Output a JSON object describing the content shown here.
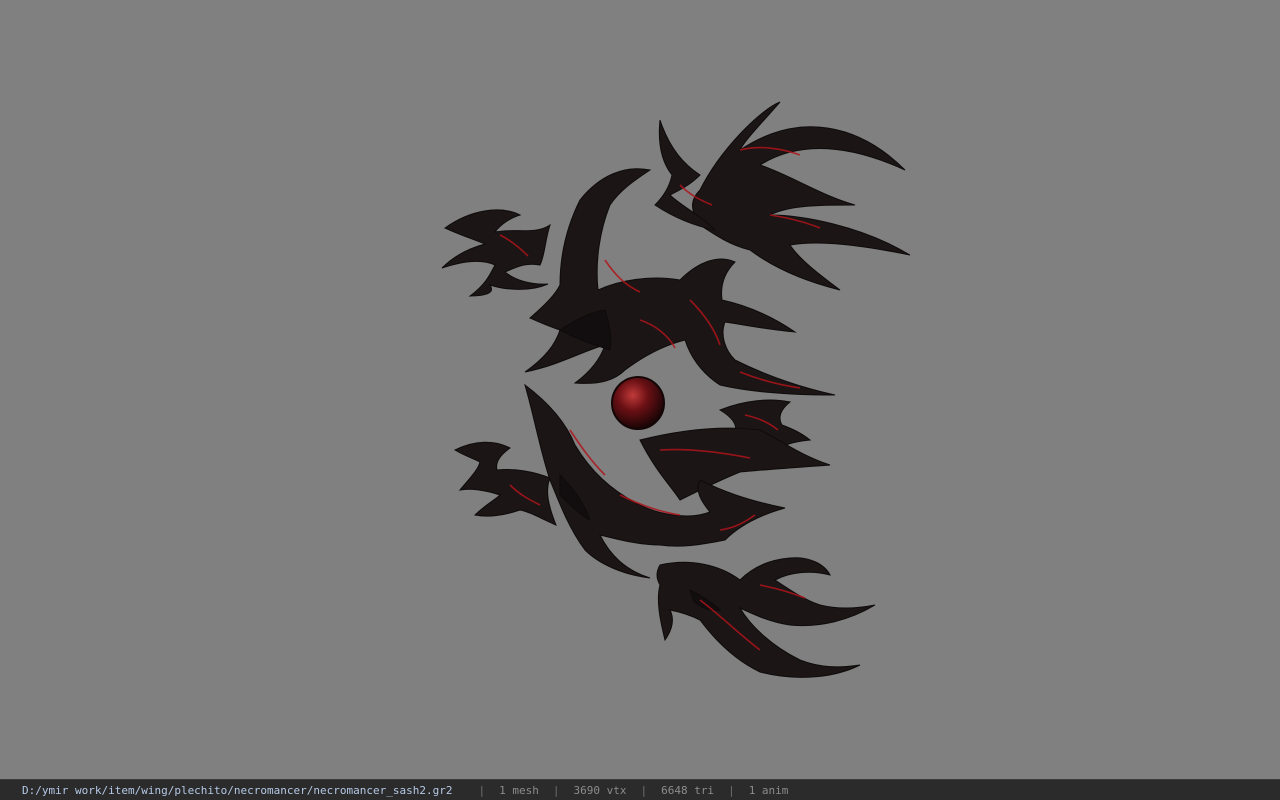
{
  "viewport": {
    "background_color": "#808080",
    "model_colors": {
      "body": "#1b1516",
      "glow": "#b0141a",
      "orb": "#5a0d10",
      "orb_highlight": "#c03a3a"
    }
  },
  "statusbar": {
    "file_path": "D:/ymir work/item/wing/plechito/necromancer/necromancer_sash2.gr2",
    "mesh_count": "1 mesh",
    "vertex_count": "3690 vtx",
    "triangle_count": "6648 tri",
    "anim_count": "1 anim",
    "separator": "|"
  }
}
